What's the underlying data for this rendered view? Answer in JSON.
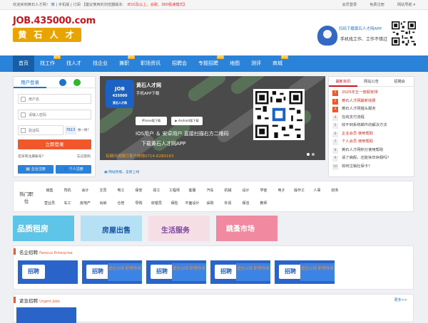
{
  "topbar": {
    "welcome": "欢迎来到黄石人才网！",
    "wechat": "微",
    "mobile": "手机版",
    "subscribe": "订阅",
    "browser_tip": "【建议使用的浏览器版本：",
    "browser_ver": "IE10及以上、谷歌、360极速模式】",
    "member_login": "会员登录",
    "free_register": "免费注册",
    "site_nav": "网站导航 ▾"
  },
  "logo": {
    "domain": "JOB.435000.com",
    "name": "黄 石 人 才 网"
  },
  "app_ad": {
    "line1": "扫码下载黄石人才网APP",
    "line2": "手机找工作、工作不错过"
  },
  "nav": {
    "items": [
      {
        "label": "首页",
        "new": ""
      },
      {
        "label": "找工作",
        "new": "NEW"
      },
      {
        "label": "找人才",
        "new": ""
      },
      {
        "label": "找企业",
        "new": ""
      },
      {
        "label": "兼职",
        "new": "NEW"
      },
      {
        "label": "职场资讯",
        "new": ""
      },
      {
        "label": "招聘会",
        "new": ""
      },
      {
        "label": "专题招聘",
        "new": "NEW"
      },
      {
        "label": "地图",
        "new": ""
      },
      {
        "label": "测评",
        "new": ""
      },
      {
        "label": "商城",
        "new": "NEW"
      }
    ]
  },
  "login": {
    "tab": "用户登录",
    "username_ph": "用户名",
    "password_ph": "请输入密码",
    "captcha_ph": "验证码",
    "captcha_code": "7613",
    "swap": "换一换？",
    "submit": "立即登录",
    "no_account": "还没有注册账号？",
    "forgot": "忘记密码",
    "company_reg": "企业注册",
    "personal_reg": "个人注册"
  },
  "banner": {
    "app_logo_top": "JOB",
    "app_logo_num": "435000",
    "app_logo_name": "黄石人才网",
    "title": "黄石人才网",
    "subtitle": "手机APP下载",
    "iphone": "iPhone版下载",
    "android": "Android版下载",
    "line1": "IOS用户 ＆ 安卓用户 直接扫描右方二维码",
    "line2": "下载黄石人才网APP",
    "phone": "有疑问请拨打客户热线0714-6280163"
  },
  "mobile_link": "网站改版，全新上线",
  "news": {
    "tabs": [
      "最新资讯",
      "网站公告",
      "招聘会"
    ],
    "items": [
      {
        "n": "1",
        "text": "2025年五一放假安排",
        "red": true
      },
      {
        "n": "2",
        "text": "黄石人才网最新收费",
        "red": true
      },
      {
        "n": "3",
        "text": "黄石人才网猎头服务",
        "red": false
      },
      {
        "n": "4",
        "text": "在线支付流程",
        "red": false
      },
      {
        "n": "5",
        "text": "收不到系统邮件的解决方法",
        "red": false
      },
      {
        "n": "6",
        "text": "企业会员 使用帮助",
        "red": true
      },
      {
        "n": "7",
        "text": "个人会员 使用帮助",
        "red": true
      },
      {
        "n": "8",
        "text": "黄石人才网积分使用帮助",
        "red": false
      },
      {
        "n": "9",
        "text": "请了病假，还能休年休假吗？",
        "red": false
      },
      {
        "n": "10",
        "text": "如何注销社保卡？",
        "red": false
      }
    ]
  },
  "categories": {
    "label": "热门职位",
    "row1": [
      "销售",
      "司机",
      "会计",
      "文员",
      "电工",
      "保安",
      "焊工",
      "工程师",
      "客服",
      "汽车",
      "机械",
      "设计",
      "学徒",
      "电子",
      "操作工",
      "人事",
      "财务"
    ],
    "row2": [
      "营业员",
      "车工",
      "房地产",
      "出纳",
      "仓管",
      "导购",
      "收银员",
      "保险",
      "平面设计",
      "采购",
      "外贸",
      "保洁",
      "教师"
    ]
  },
  "ads": [
    "品质租房",
    "房屋出售",
    "生活服务",
    "跳蚤市场"
  ],
  "famous": {
    "title": "名企招聘",
    "en": "Famous Enterprise",
    "banners": [
      {
        "z": "招聘",
        "txt": ""
      },
      {
        "z": "招聘",
        "txt": "虚位以待 职等你来"
      },
      {
        "z": "招聘",
        "txt": "虚位以待 职等你来"
      },
      {
        "z": "招聘",
        "txt": "虚位以待 职等你来"
      },
      {
        "z": "招聘",
        "txt": "虚位以待 职等你来"
      }
    ]
  },
  "urgent": {
    "title": "紧急招聘",
    "en": "Urgent Jobs",
    "more": "更多>>"
  }
}
